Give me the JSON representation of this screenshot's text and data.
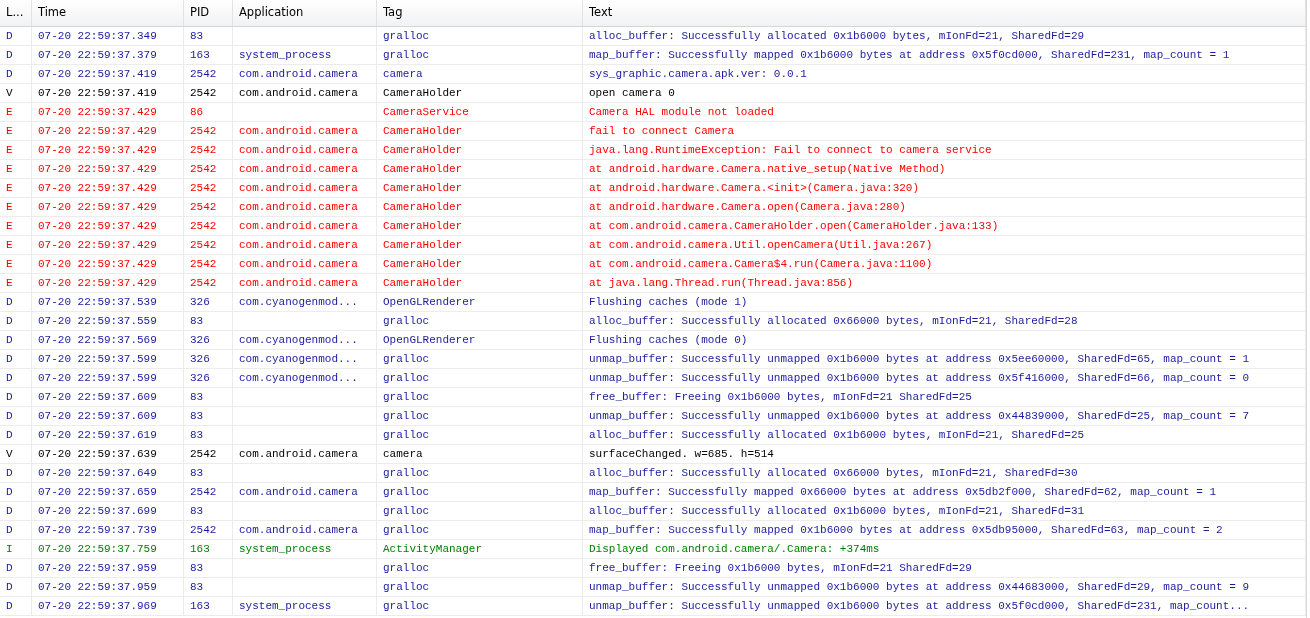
{
  "table": {
    "columns": [
      "L...",
      "Time",
      "PID",
      "Application",
      "Tag",
      "Text"
    ],
    "rows": [
      {
        "kind": "debug",
        "priority": "D",
        "time": "07-20 22:59:37.349",
        "pid": "83",
        "tag": "gralloc",
        "text": "alloc_buffer: Successfully allocated 0x1b6000 bytes, mIonFd=21, SharedFd=29"
      },
      {
        "kind": "debug",
        "priority": "D",
        "time": "07-20 22:59:37.379",
        "pid": "163",
        "application": "system_process",
        "tag": "gralloc",
        "text": "map_buffer: Successfully mapped 0x1b6000 bytes at address 0x5f0cd000, SharedFd=231, map_count = 1"
      },
      {
        "kind": "debug",
        "priority": "D",
        "time": "07-20 22:59:37.419",
        "pid": "2542",
        "application": "com.android.camera",
        "tag": "camera",
        "text": "sys_graphic.camera.apk.ver: 0.0.1"
      },
      {
        "kind": "verbose",
        "priority": "V",
        "time": "07-20 22:59:37.419",
        "pid": "2542",
        "application": "com.android.camera",
        "tag": "CameraHolder",
        "text": "open camera 0"
      },
      {
        "kind": "error",
        "priority": "E",
        "time": "07-20 22:59:37.429",
        "pid": "86",
        "tag": "CameraService",
        "text": "Camera HAL module not loaded"
      },
      {
        "kind": "error",
        "priority": "E",
        "time": "07-20 22:59:37.429",
        "pid": "2542",
        "application": "com.android.camera",
        "tag": "CameraHolder",
        "text": "fail to connect Camera"
      },
      {
        "kind": "error",
        "priority": "E",
        "time": "07-20 22:59:37.429",
        "pid": "2542",
        "application": "com.android.camera",
        "tag": "CameraHolder",
        "text": "java.lang.RuntimeException: Fail to connect to camera service"
      },
      {
        "kind": "error",
        "priority": "E",
        "time": "07-20 22:59:37.429",
        "pid": "2542",
        "application": "com.android.camera",
        "tag": "CameraHolder",
        "text": "at android.hardware.Camera.native_setup(Native Method)"
      },
      {
        "kind": "error",
        "priority": "E",
        "time": "07-20 22:59:37.429",
        "pid": "2542",
        "application": "com.android.camera",
        "tag": "CameraHolder",
        "text": "at android.hardware.Camera.<init>(Camera.java:320)"
      },
      {
        "kind": "error",
        "priority": "E",
        "time": "07-20 22:59:37.429",
        "pid": "2542",
        "application": "com.android.camera",
        "tag": "CameraHolder",
        "text": "at android.hardware.Camera.open(Camera.java:280)"
      },
      {
        "kind": "error",
        "priority": "E",
        "time": "07-20 22:59:37.429",
        "pid": "2542",
        "application": "com.android.camera",
        "tag": "CameraHolder",
        "text": "at com.android.camera.CameraHolder.open(CameraHolder.java:133)"
      },
      {
        "kind": "error",
        "priority": "E",
        "time": "07-20 22:59:37.429",
        "pid": "2542",
        "application": "com.android.camera",
        "tag": "CameraHolder",
        "text": "at com.android.camera.Util.openCamera(Util.java:267)"
      },
      {
        "kind": "error",
        "priority": "E",
        "time": "07-20 22:59:37.429",
        "pid": "2542",
        "application": "com.android.camera",
        "tag": "CameraHolder",
        "text": "at com.android.camera.Camera$4.run(Camera.java:1100)"
      },
      {
        "kind": "error",
        "priority": "E",
        "time": "07-20 22:59:37.429",
        "pid": "2542",
        "application": "com.android.camera",
        "tag": "CameraHolder",
        "text": "at java.lang.Thread.run(Thread.java:856)"
      },
      {
        "kind": "debug",
        "priority": "D",
        "time": "07-20 22:59:37.539",
        "pid": "326",
        "application": "com.cyanogenmod...",
        "tag": "OpenGLRenderer",
        "text": "Flushing caches (mode 1)"
      },
      {
        "kind": "debug",
        "priority": "D",
        "time": "07-20 22:59:37.559",
        "pid": "83",
        "tag": "gralloc",
        "text": "alloc_buffer: Successfully allocated 0x66000 bytes, mIonFd=21, SharedFd=28"
      },
      {
        "kind": "debug",
        "priority": "D",
        "time": "07-20 22:59:37.569",
        "pid": "326",
        "application": "com.cyanogenmod...",
        "tag": "OpenGLRenderer",
        "text": "Flushing caches (mode 0)"
      },
      {
        "kind": "debug",
        "priority": "D",
        "time": "07-20 22:59:37.599",
        "pid": "326",
        "application": "com.cyanogenmod...",
        "tag": "gralloc",
        "text": "unmap_buffer: Successfully unmapped 0x1b6000 bytes at address 0x5ee60000, SharedFd=65, map_count = 1"
      },
      {
        "kind": "debug",
        "priority": "D",
        "time": "07-20 22:59:37.599",
        "pid": "326",
        "application": "com.cyanogenmod...",
        "tag": "gralloc",
        "text": "unmap_buffer: Successfully unmapped 0x1b6000 bytes at address 0x5f416000, SharedFd=66, map_count = 0"
      },
      {
        "kind": "debug",
        "priority": "D",
        "time": "07-20 22:59:37.609",
        "pid": "83",
        "tag": "gralloc",
        "text": "free_buffer: Freeing 0x1b6000 bytes, mIonFd=21 SharedFd=25"
      },
      {
        "kind": "debug",
        "priority": "D",
        "time": "07-20 22:59:37.609",
        "pid": "83",
        "tag": "gralloc",
        "text": "unmap_buffer: Successfully unmapped 0x1b6000 bytes at address 0x44839000, SharedFd=25, map_count = 7"
      },
      {
        "kind": "debug",
        "priority": "D",
        "time": "07-20 22:59:37.619",
        "pid": "83",
        "tag": "gralloc",
        "text": "alloc_buffer: Successfully allocated 0x1b6000 bytes, mIonFd=21, SharedFd=25"
      },
      {
        "kind": "verbose",
        "priority": "V",
        "time": "07-20 22:59:37.639",
        "pid": "2542",
        "application": "com.android.camera",
        "tag": "camera",
        "text": "surfaceChanged. w=685. h=514"
      },
      {
        "kind": "debug",
        "priority": "D",
        "time": "07-20 22:59:37.649",
        "pid": "83",
        "tag": "gralloc",
        "text": "alloc_buffer: Successfully allocated 0x66000 bytes, mIonFd=21, SharedFd=30"
      },
      {
        "kind": "debug",
        "priority": "D",
        "time": "07-20 22:59:37.659",
        "pid": "2542",
        "application": "com.android.camera",
        "tag": "gralloc",
        "text": "map_buffer: Successfully mapped 0x66000 bytes at address 0x5db2f000, SharedFd=62, map_count = 1"
      },
      {
        "kind": "debug",
        "priority": "D",
        "time": "07-20 22:59:37.699",
        "pid": "83",
        "tag": "gralloc",
        "text": "alloc_buffer: Successfully allocated 0x1b6000 bytes, mIonFd=21, SharedFd=31"
      },
      {
        "kind": "debug",
        "priority": "D",
        "time": "07-20 22:59:37.739",
        "pid": "2542",
        "application": "com.android.camera",
        "tag": "gralloc",
        "text": "map_buffer: Successfully mapped 0x1b6000 bytes at address 0x5db95000, SharedFd=63, map_count = 2"
      },
      {
        "kind": "info",
        "priority": "I",
        "time": "07-20 22:59:37.759",
        "pid": "163",
        "application": "system_process",
        "tag": "ActivityManager",
        "text": "Displayed com.android.camera/.Camera: +374ms"
      },
      {
        "kind": "debug",
        "priority": "D",
        "time": "07-20 22:59:37.959",
        "pid": "83",
        "tag": "gralloc",
        "text": "free_buffer: Freeing 0x1b6000 bytes, mIonFd=21 SharedFd=29"
      },
      {
        "kind": "debug",
        "priority": "D",
        "time": "07-20 22:59:37.959",
        "pid": "83",
        "tag": "gralloc",
        "text": "unmap_buffer: Successfully unmapped 0x1b6000 bytes at address 0x44683000, SharedFd=29, map_count = 9"
      },
      {
        "kind": "debug",
        "priority": "D",
        "time": "07-20 22:59:37.969",
        "pid": "163",
        "application": "system_process",
        "tag": "gralloc",
        "text": "unmap_buffer: Successfully unmapped 0x1b6000 bytes at address 0x5f0cd000, SharedFd=231, map_count..."
      }
    ]
  }
}
